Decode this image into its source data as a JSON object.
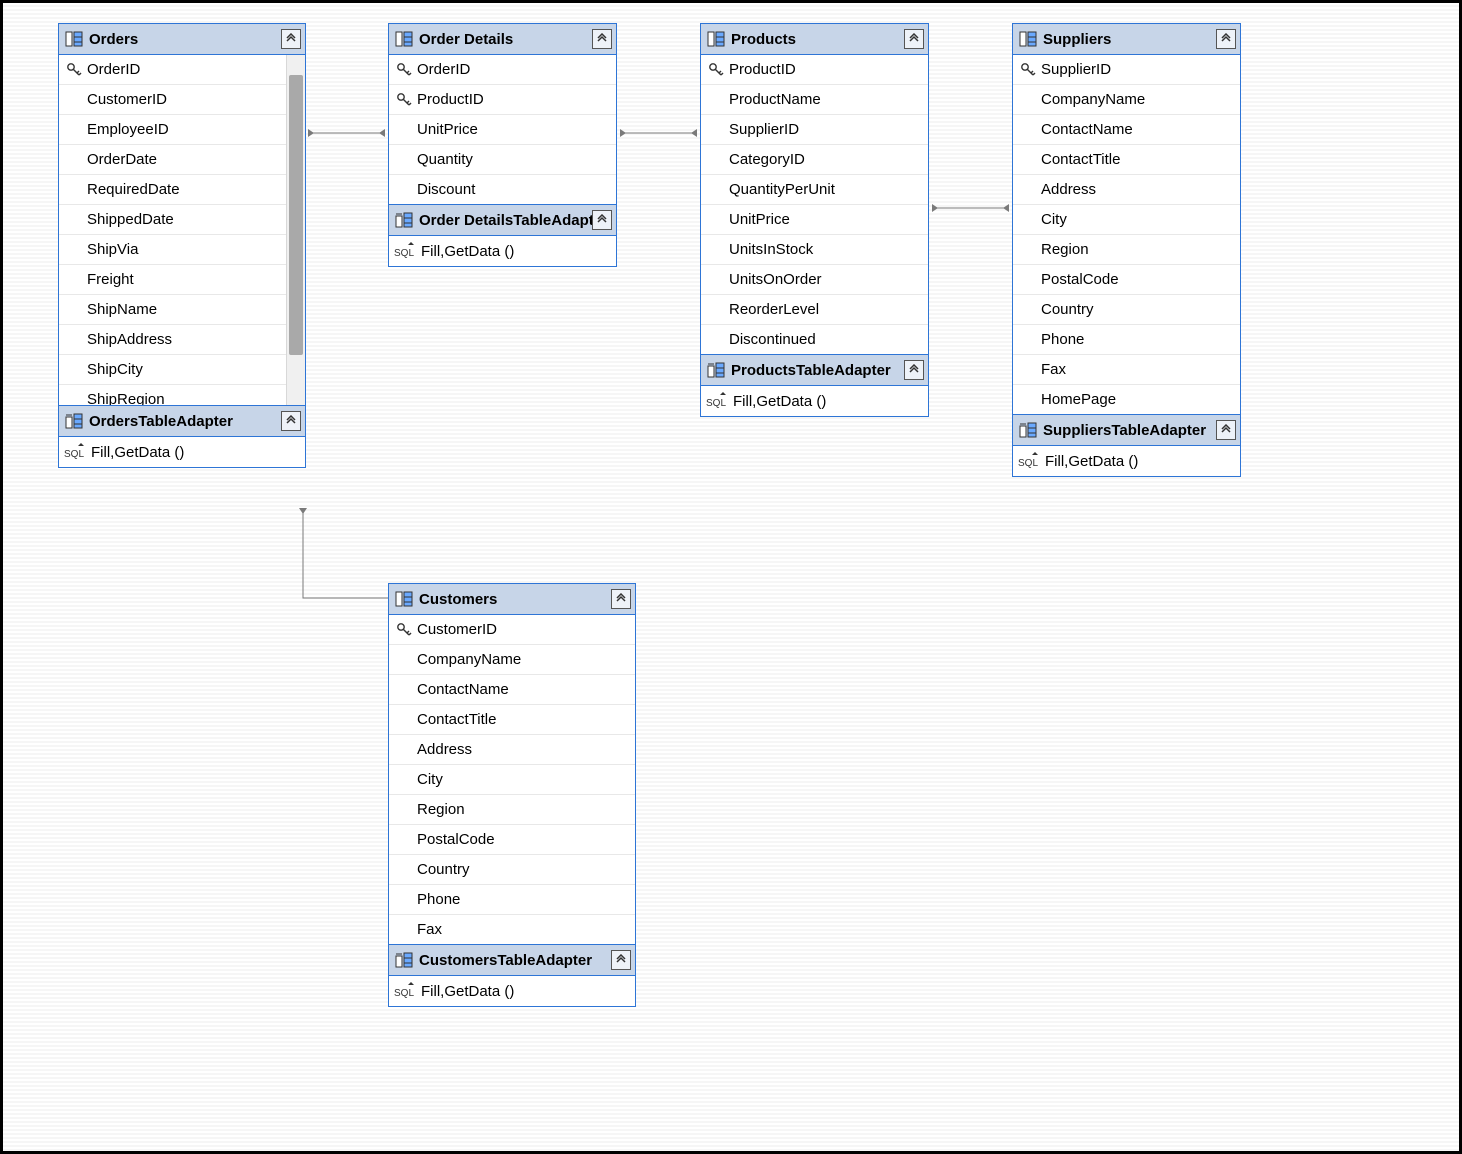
{
  "tables": {
    "orders": {
      "title": "Orders",
      "columns": [
        {
          "name": "OrderID",
          "pk": true
        },
        {
          "name": "CustomerID",
          "pk": false
        },
        {
          "name": "EmployeeID",
          "pk": false
        },
        {
          "name": "OrderDate",
          "pk": false
        },
        {
          "name": "RequiredDate",
          "pk": false
        },
        {
          "name": "ShippedDate",
          "pk": false
        },
        {
          "name": "ShipVia",
          "pk": false
        },
        {
          "name": "Freight",
          "pk": false
        },
        {
          "name": "ShipName",
          "pk": false
        },
        {
          "name": "ShipAddress",
          "pk": false
        },
        {
          "name": "ShipCity",
          "pk": false
        },
        {
          "name": "ShipRegion",
          "pk": false
        }
      ],
      "adapter": "OrdersTableAdapter",
      "method": "Fill,GetData ()"
    },
    "orderdetails": {
      "title": "Order Details",
      "columns": [
        {
          "name": "OrderID",
          "pk": true
        },
        {
          "name": "ProductID",
          "pk": true
        },
        {
          "name": "UnitPrice",
          "pk": false
        },
        {
          "name": "Quantity",
          "pk": false
        },
        {
          "name": "Discount",
          "pk": false
        }
      ],
      "adapter": "Order DetailsTableAdapter",
      "method": "Fill,GetData ()"
    },
    "products": {
      "title": "Products",
      "columns": [
        {
          "name": "ProductID",
          "pk": true
        },
        {
          "name": "ProductName",
          "pk": false
        },
        {
          "name": "SupplierID",
          "pk": false
        },
        {
          "name": "CategoryID",
          "pk": false
        },
        {
          "name": "QuantityPerUnit",
          "pk": false
        },
        {
          "name": "UnitPrice",
          "pk": false
        },
        {
          "name": "UnitsInStock",
          "pk": false
        },
        {
          "name": "UnitsOnOrder",
          "pk": false
        },
        {
          "name": "ReorderLevel",
          "pk": false
        },
        {
          "name": "Discontinued",
          "pk": false
        }
      ],
      "adapter": "ProductsTableAdapter",
      "method": "Fill,GetData ()"
    },
    "suppliers": {
      "title": "Suppliers",
      "columns": [
        {
          "name": "SupplierID",
          "pk": true
        },
        {
          "name": "CompanyName",
          "pk": false
        },
        {
          "name": "ContactName",
          "pk": false
        },
        {
          "name": "ContactTitle",
          "pk": false
        },
        {
          "name": "Address",
          "pk": false
        },
        {
          "name": "City",
          "pk": false
        },
        {
          "name": "Region",
          "pk": false
        },
        {
          "name": "PostalCode",
          "pk": false
        },
        {
          "name": "Country",
          "pk": false
        },
        {
          "name": "Phone",
          "pk": false
        },
        {
          "name": "Fax",
          "pk": false
        },
        {
          "name": "HomePage",
          "pk": false
        }
      ],
      "adapter": "SuppliersTableAdapter",
      "method": "Fill,GetData ()"
    },
    "customers": {
      "title": "Customers",
      "columns": [
        {
          "name": "CustomerID",
          "pk": true
        },
        {
          "name": "CompanyName",
          "pk": false
        },
        {
          "name": "ContactName",
          "pk": false
        },
        {
          "name": "ContactTitle",
          "pk": false
        },
        {
          "name": "Address",
          "pk": false
        },
        {
          "name": "City",
          "pk": false
        },
        {
          "name": "Region",
          "pk": false
        },
        {
          "name": "PostalCode",
          "pk": false
        },
        {
          "name": "Country",
          "pk": false
        },
        {
          "name": "Phone",
          "pk": false
        },
        {
          "name": "Fax",
          "pk": false
        }
      ],
      "adapter": "CustomersTableAdapter",
      "method": "Fill,GetData ()"
    }
  }
}
